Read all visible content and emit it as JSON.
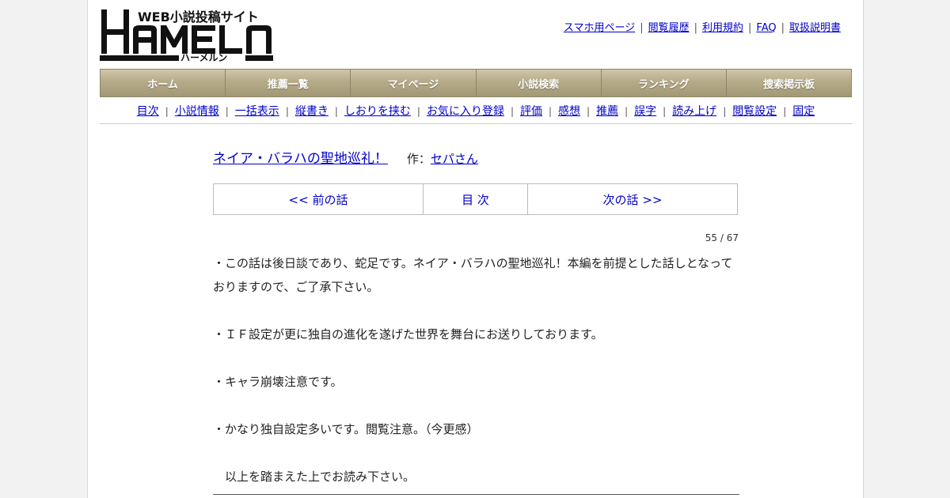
{
  "header": {
    "logo_text": "HAMELN",
    "logo_tagline": "WEB小説投稿サイト",
    "logo_kana": "ハーメルン",
    "links": [
      {
        "label": "スマホ用ページ"
      },
      {
        "label": "閲覧履歴"
      },
      {
        "label": "利用規約"
      },
      {
        "label": "FAQ"
      },
      {
        "label": "取扱説明書"
      }
    ]
  },
  "main_nav": [
    {
      "label": "ホーム"
    },
    {
      "label": "推薦一覧"
    },
    {
      "label": "マイページ"
    },
    {
      "label": "小説検索"
    },
    {
      "label": "ランキング"
    },
    {
      "label": "捜索掲示板"
    }
  ],
  "sub_nav": [
    {
      "label": "目次"
    },
    {
      "label": "小説情報"
    },
    {
      "label": "一括表示"
    },
    {
      "label": "縦書き"
    },
    {
      "label": "しおりを挟む"
    },
    {
      "label": "お気に入り登録"
    },
    {
      "label": "評価"
    },
    {
      "label": "感想"
    },
    {
      "label": "推薦"
    },
    {
      "label": "誤字"
    },
    {
      "label": "読み上げ"
    },
    {
      "label": "閲覧設定"
    },
    {
      "label": "固定"
    }
  ],
  "novel": {
    "title": "ネイア・バラハの聖地巡礼！",
    "author_prefix": "作：",
    "author": "セパさん"
  },
  "chapter_nav": {
    "prev": "<< 前の話",
    "toc": "目 次",
    "next": "次の話 >>"
  },
  "page_count": "55 / 67",
  "body": {
    "p1": "・この話は後日談であり、蛇足です。ネイア・バラハの聖地巡礼！本編を前提とした話しとなっておりますので、ご了承下さい。",
    "p2": "・ＩＦ設定が更に独自の進化を遂げた世界を舞台にお送りしております。",
    "p3": "・キャラ崩壊注意です。",
    "p4": "・かなり独自設定多いです。閲覧注意。（今更感）",
    "p5": "　以上を踏まえた上でお読み下さい。"
  },
  "colors": {
    "link": "#0000cc",
    "nav_bg": "#b6ab88",
    "page_bg": "#f2f2f2"
  }
}
